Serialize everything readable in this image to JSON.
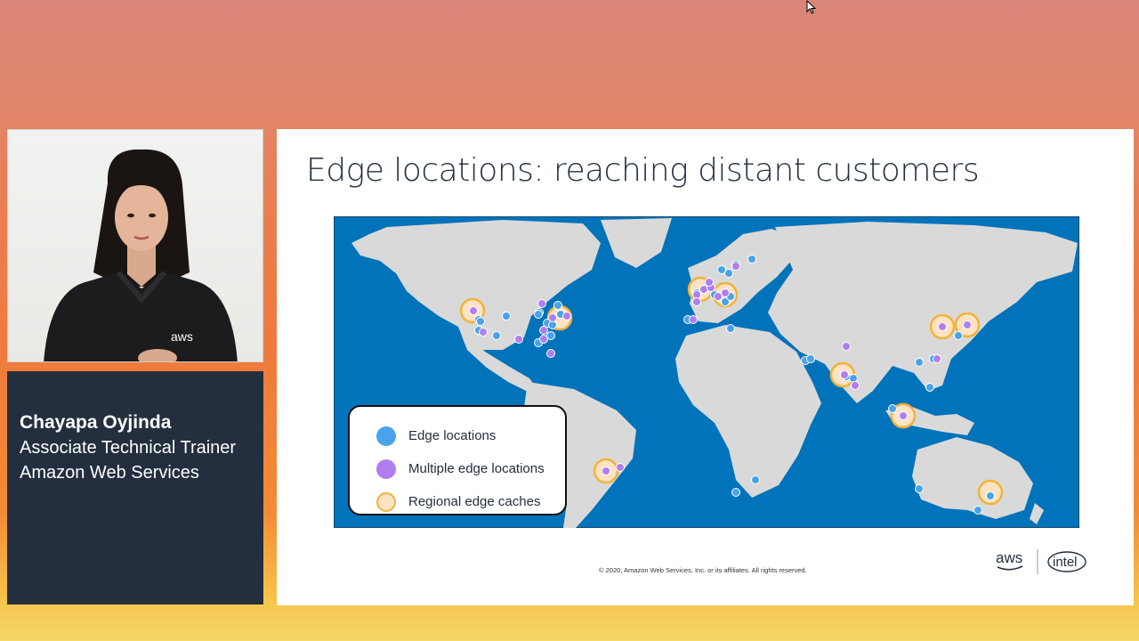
{
  "presenter": {
    "name": "Chayapa Oyjinda",
    "role": "Associate Technical Trainer",
    "company": "Amazon Web Services",
    "shirt_logo": "aws"
  },
  "slide": {
    "title": "Edge locations: reaching distant customers",
    "legend": {
      "items": [
        {
          "label": "Edge locations",
          "color": "#4aa3e8"
        },
        {
          "label": "Multiple edge locations",
          "color": "#b07ef0"
        },
        {
          "label": "Regional edge caches",
          "color": "#fde3c4"
        }
      ],
      "cache_ring_color": "#f0b43a"
    },
    "copyright": "© 2020, Amazon Web Services, Inc. or its affiliates. All rights reserved.",
    "logos": {
      "aws": "aws",
      "intel": "intel"
    },
    "colors": {
      "ocean": "#0073bb",
      "land": "#d9d9d9"
    }
  }
}
